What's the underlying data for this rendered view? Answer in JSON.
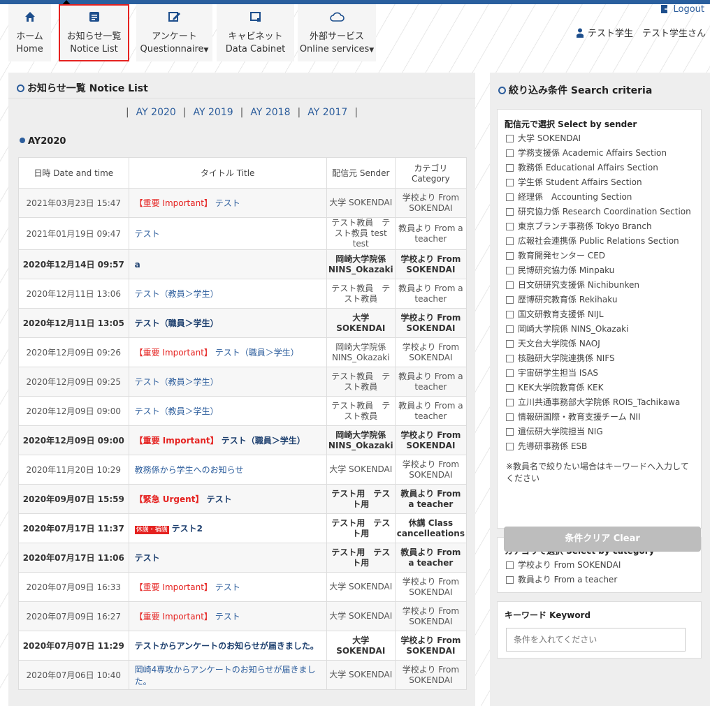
{
  "nav": {
    "home": {
      "jp": "ホーム",
      "en": "Home"
    },
    "notice": {
      "jp": "お知らせ一覧",
      "en": "Notice List"
    },
    "questionnaire": {
      "jp": "アンケート",
      "en": "Questionnaire"
    },
    "cabinet": {
      "jp": "キャビネット",
      "en": "Data Cabinet"
    },
    "online": {
      "jp": "外部サービス",
      "en": "Online services"
    }
  },
  "user": {
    "logout": "Logout",
    "name": "テスト学生　テスト学生さん"
  },
  "notice_panel": {
    "title": "お知らせ一覧 Notice List",
    "years": [
      "AY 2020",
      "AY 2019",
      "AY 2018",
      "AY 2017"
    ],
    "current_year": "AY2020",
    "columns": {
      "date": "日時 Date and time",
      "title": "タイトル Title",
      "sender": "配信元 Sender",
      "category": "カテゴリ Category"
    },
    "rows": [
      {
        "date": "2021年03月23日 15:47",
        "tag": "【重要 Important】",
        "badge": "",
        "title": "テスト",
        "sender": "大学 SOKENDAI",
        "category": "学校より From SOKENDAI"
      },
      {
        "date": "2021年01月19日 09:47",
        "tag": "",
        "badge": "",
        "title": "テスト",
        "sender": "テスト教員　テスト教員 test test",
        "category": "教員より From a teacher"
      },
      {
        "date": "2020年12月14日 09:57",
        "tag": "",
        "badge": "",
        "title": "a",
        "sender": "岡崎大学院係 NINS_Okazaki",
        "category": "学校より From SOKENDAI"
      },
      {
        "date": "2020年12月11日 13:06",
        "tag": "",
        "badge": "",
        "title": "テスト（教員＞学生）",
        "sender": "テスト教員　テスト教員",
        "category": "教員より From a teacher"
      },
      {
        "date": "2020年12月11日 13:05",
        "tag": "",
        "badge": "",
        "title": "テスト（職員＞学生）",
        "sender": "大学 SOKENDAI",
        "category": "学校より From SOKENDAI"
      },
      {
        "date": "2020年12月09日 09:26",
        "tag": "【重要 Important】",
        "badge": "",
        "title": "テスト（職員＞学生）",
        "sender": "岡崎大学院係 NINS_Okazaki",
        "category": "学校より From SOKENDAI"
      },
      {
        "date": "2020年12月09日 09:25",
        "tag": "",
        "badge": "",
        "title": "テスト（教員＞学生）",
        "sender": "テスト教員　テスト教員",
        "category": "教員より From a teacher"
      },
      {
        "date": "2020年12月09日 09:00",
        "tag": "",
        "badge": "",
        "title": "テスト（教員＞学生）",
        "sender": "テスト教員　テスト教員",
        "category": "教員より From a teacher"
      },
      {
        "date": "2020年12月09日 09:00",
        "tag": "【重要 Important】",
        "badge": "",
        "title": "テスト（職員＞学生）",
        "sender": "岡崎大学院係 NINS_Okazaki",
        "category": "学校より From SOKENDAI"
      },
      {
        "date": "2020年11月20日 10:29",
        "tag": "",
        "badge": "",
        "title": "教務係から学生へのお知らせ",
        "sender": "大学 SOKENDAI",
        "category": "学校より From SOKENDAI"
      },
      {
        "date": "2020年09月07日 15:59",
        "tag": "【緊急 Urgent】",
        "badge": "",
        "title": "テスト",
        "sender": "テスト用　テスト用",
        "category": "教員より From a teacher"
      },
      {
        "date": "2020年07月17日 11:37",
        "tag": "",
        "badge": "休講・補講",
        "title": "テスト2",
        "sender": "テスト用　テスト用",
        "category": "休講 Class cancelleations"
      },
      {
        "date": "2020年07月17日 11:06",
        "tag": "",
        "badge": "",
        "title": "テスト",
        "sender": "テスト用　テスト用",
        "category": "教員より From a teacher"
      },
      {
        "date": "2020年07月09日 16:33",
        "tag": "【重要 Important】",
        "badge": "",
        "title": "テスト",
        "sender": "大学 SOKENDAI",
        "category": "学校より From SOKENDAI"
      },
      {
        "date": "2020年07月09日 16:27",
        "tag": "【重要 Important】",
        "badge": "",
        "title": "テスト",
        "sender": "大学 SOKENDAI",
        "category": "学校より From SOKENDAI"
      },
      {
        "date": "2020年07月07日 11:29",
        "tag": "",
        "badge": "",
        "title": "テストからアンケートのお知らせが届きました。",
        "sender": "大学 SOKENDAI",
        "category": "学校より From SOKENDAI"
      },
      {
        "date": "2020年07月06日 10:40",
        "tag": "",
        "badge": "",
        "title": "岡崎4専攻からアンケートのお知らせが届きました。",
        "sender": "大学 SOKENDAI",
        "category": "学校より From SOKENDAI"
      }
    ]
  },
  "search_panel": {
    "title": "絞り込み条件 Search criteria",
    "sender_head": "配信元で選択 Select by sender",
    "senders": [
      "大学 SOKENDAI",
      "学務支援係 Academic Affairs Section",
      "教務係 Educational Affairs Section",
      "学生係 Student Affairs Section",
      "経理係　Accounting Section",
      "研究協力係 Research Coordination Section",
      "東京ブランチ事務係 Tokyo Branch",
      "広報社会連携係 Public Relations Section",
      "教育開発センター CED",
      "民博研究協力係 Minpaku",
      "日文研研究支援係 Nichibunken",
      "歴博研究教育係 Rekihaku",
      "国文研教育支援係 NIJL",
      "岡崎大学院係 NINS_Okazaki",
      "天文台大学院係 NAOJ",
      "核融研大学院連携係 NIFS",
      "宇宙研学生担当 ISAS",
      "KEK大学院教育係 KEK",
      "立川共通事務部大学院係 ROIS_Tachikawa",
      "情報研国際・教育支援チーム NII",
      "遺伝研大学院担当 NIG",
      "先導研事務係 ESB"
    ],
    "note": "※教員名で絞りたい場合はキーワードへ入力してください",
    "category_head": "カテゴリで選択 Select by category",
    "categories": [
      "学校より From SOKENDAI",
      "教員より From a teacher"
    ],
    "keyword_head": "キーワード Keyword",
    "keyword_placeholder": "条件を入れてください",
    "clear": "条件クリア Clear"
  }
}
